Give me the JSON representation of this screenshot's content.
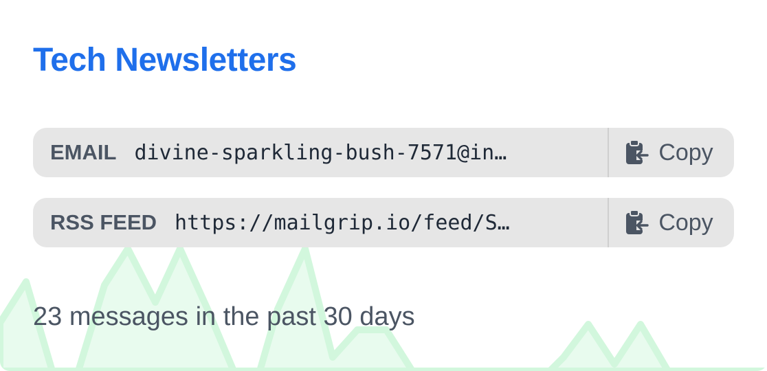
{
  "newsletter": {
    "title": "Tech Newsletters"
  },
  "email": {
    "label": "EMAIL",
    "value": "divine-sparkling-bush-7571@in…",
    "copy_label": "Copy",
    "copy_icon": "clipboard-copy-icon"
  },
  "rss": {
    "label": "RSS FEED",
    "value": "https://mailgrip.io/feed/S…",
    "copy_label": "Copy",
    "copy_icon": "clipboard-copy-icon"
  },
  "stats": {
    "text": "23 messages in the past 30 days"
  },
  "colors": {
    "title": "#1f6feb",
    "row_background": "#e6e6e6",
    "sparkline_fill": "#e8fbee",
    "sparkline_stroke": "#d2f7dd",
    "muted_text": "#4b5563"
  }
}
